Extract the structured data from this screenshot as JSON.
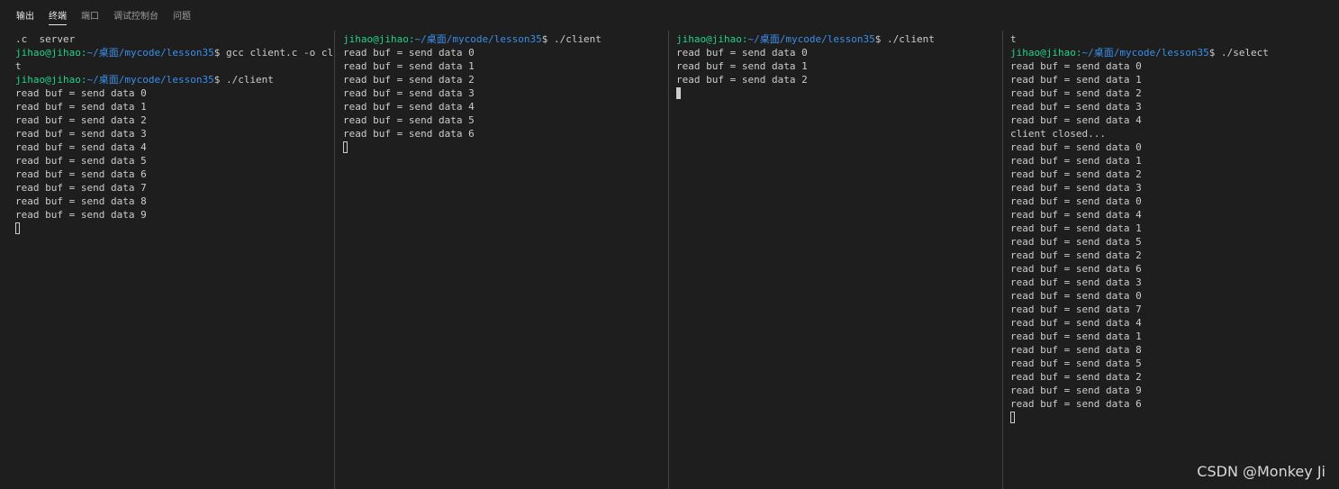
{
  "tabs": [
    {
      "label": "输出"
    },
    {
      "label": "终端"
    },
    {
      "label": "端口"
    },
    {
      "label": "调试控制台"
    },
    {
      "label": "问题"
    }
  ],
  "active_tab": "终端",
  "colors": {
    "background": "#1e1e1e",
    "text": "#cccccc",
    "prompt_user": "#23d18b",
    "prompt_path": "#3b8eea",
    "divider": "#444444"
  },
  "terminals": [
    {
      "lines": [
        {
          "type": "text",
          "text": ".c  server"
        },
        {
          "type": "prompt",
          "user": "jihao@jihao:",
          "path": "~/桌面/mycode/lesson35",
          "cmd": "$ gcc client.c -o clien"
        },
        {
          "type": "text",
          "text": "t"
        },
        {
          "type": "prompt",
          "user": "jihao@jihao:",
          "path": "~/桌面/mycode/lesson35",
          "cmd": "$ ./client"
        },
        {
          "type": "text",
          "text": "read buf = send data 0"
        },
        {
          "type": "text",
          "text": "read buf = send data 1"
        },
        {
          "type": "text",
          "text": "read buf = send data 2"
        },
        {
          "type": "text",
          "text": "read buf = send data 3"
        },
        {
          "type": "text",
          "text": "read buf = send data 4"
        },
        {
          "type": "text",
          "text": "read buf = send data 5"
        },
        {
          "type": "text",
          "text": "read buf = send data 6"
        },
        {
          "type": "text",
          "text": "read buf = send data 7"
        },
        {
          "type": "text",
          "text": "read buf = send data 8"
        },
        {
          "type": "text",
          "text": "read buf = send data 9"
        },
        {
          "type": "cursor",
          "style": "hollow"
        }
      ]
    },
    {
      "lines": [
        {
          "type": "prompt",
          "user": "jihao@jihao:",
          "path": "~/桌面/mycode/lesson35",
          "cmd": "$ ./client"
        },
        {
          "type": "text",
          "text": "read buf = send data 0"
        },
        {
          "type": "text",
          "text": "read buf = send data 1"
        },
        {
          "type": "text",
          "text": "read buf = send data 2"
        },
        {
          "type": "text",
          "text": "read buf = send data 3"
        },
        {
          "type": "text",
          "text": "read buf = send data 4"
        },
        {
          "type": "text",
          "text": "read buf = send data 5"
        },
        {
          "type": "text",
          "text": "read buf = send data 6"
        },
        {
          "type": "cursor",
          "style": "hollow"
        }
      ]
    },
    {
      "lines": [
        {
          "type": "prompt",
          "user": "jihao@jihao:",
          "path": "~/桌面/mycode/lesson35",
          "cmd": "$ ./client"
        },
        {
          "type": "text",
          "text": "read buf = send data 0"
        },
        {
          "type": "text",
          "text": "read buf = send data 1"
        },
        {
          "type": "text",
          "text": "read buf = send data 2"
        },
        {
          "type": "cursor",
          "style": "solid"
        }
      ]
    },
    {
      "lines": [
        {
          "type": "text",
          "text": "t"
        },
        {
          "type": "prompt",
          "user": "jihao@jihao:",
          "path": "~/桌面/mycode/lesson35",
          "cmd": "$ ./select"
        },
        {
          "type": "text",
          "text": "read buf = send data 0"
        },
        {
          "type": "text",
          "text": "read buf = send data 1"
        },
        {
          "type": "text",
          "text": "read buf = send data 2"
        },
        {
          "type": "text",
          "text": "read buf = send data 3"
        },
        {
          "type": "text",
          "text": "read buf = send data 4"
        },
        {
          "type": "text",
          "text": "client closed..."
        },
        {
          "type": "text",
          "text": "read buf = send data 0"
        },
        {
          "type": "text",
          "text": "read buf = send data 1"
        },
        {
          "type": "text",
          "text": "read buf = send data 2"
        },
        {
          "type": "text",
          "text": "read buf = send data 3"
        },
        {
          "type": "text",
          "text": "read buf = send data 0"
        },
        {
          "type": "text",
          "text": "read buf = send data 4"
        },
        {
          "type": "text",
          "text": "read buf = send data 1"
        },
        {
          "type": "text",
          "text": "read buf = send data 5"
        },
        {
          "type": "text",
          "text": "read buf = send data 2"
        },
        {
          "type": "text",
          "text": "read buf = send data 6"
        },
        {
          "type": "text",
          "text": "read buf = send data 3"
        },
        {
          "type": "text",
          "text": "read buf = send data 0"
        },
        {
          "type": "text",
          "text": "read buf = send data 7"
        },
        {
          "type": "text",
          "text": "read buf = send data 4"
        },
        {
          "type": "text",
          "text": "read buf = send data 1"
        },
        {
          "type": "text",
          "text": "read buf = send data 8"
        },
        {
          "type": "text",
          "text": "read buf = send data 5"
        },
        {
          "type": "text",
          "text": "read buf = send data 2"
        },
        {
          "type": "text",
          "text": "read buf = send data 9"
        },
        {
          "type": "text",
          "text": "read buf = send data 6"
        },
        {
          "type": "cursor",
          "style": "hollow"
        }
      ]
    }
  ],
  "watermark": "CSDN @Monkey Ji"
}
